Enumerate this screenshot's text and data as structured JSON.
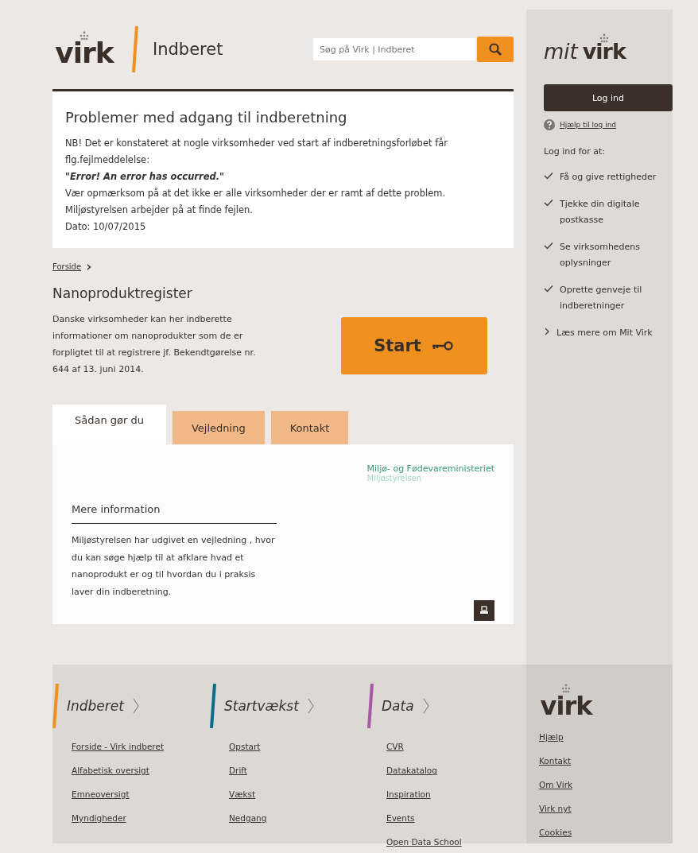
{
  "header": {
    "logo": "virk",
    "section": "Indberet",
    "search": {
      "placeholder": "Søg på Virk | Indberet"
    }
  },
  "notice": {
    "title": "Problemer med adgang til indberetning",
    "lines": [
      {
        "text": "NB! Det er konstateret at nogle virksomheder ved start af indberetningsforløbet får flg.fejlmeddelelse:",
        "emphasis": false
      },
      {
        "text": "\"Error! An error has occurred.\"",
        "emphasis": true
      },
      {
        "text": "Vær opmærksom på at det ikke er alle virksomheder der er ramt af dette problem.",
        "emphasis": false
      },
      {
        "text": "Miljøstyrelsen arbejder på at finde fejlen.",
        "emphasis": false
      },
      {
        "text": "Dato: 10/07/2015",
        "emphasis": false
      }
    ]
  },
  "breadcrumb": [
    "Forside"
  ],
  "page": {
    "title": "Nanoproduktregister",
    "intro": "Danske virksomheder kan her indberette informationer om nanoprodukter som de er forpligtet til at registrere jf. Bekendtgørelse nr. 644 af 13. juni 2014.",
    "start_button": "Start"
  },
  "tabs": [
    {
      "label": "Sådan gør du",
      "selected": true
    },
    {
      "label": "Vejledning",
      "selected": false
    },
    {
      "label": "Kontakt",
      "selected": false
    }
  ],
  "tab_panel": {
    "ministry": "Miljø- og Fødevareministeriet",
    "agency": "Miljøstyrelsen",
    "heading": "Mere information",
    "text": "Miljøstyrelsen har udgivet en vejledning , hvor du kan søge hjælp til at afklare hvad et nanoprodukt er og til hvordan du i praksis laver din indberetning."
  },
  "sidebar": {
    "logo_prefix": "mit",
    "logo": "virk",
    "login_button": "Log ind",
    "help_link": "Hjælp til log ind",
    "benefits_title": "Log ind for at:",
    "benefits": [
      "Få og give rettigheder",
      "Tjekke din digitale postkasse",
      "Se virksomhedens oplysninger",
      "Oprette genveje til indberetninger"
    ],
    "more_link": "Læs mere om Mit Virk"
  },
  "footer": {
    "columns": [
      {
        "title": "Indberet",
        "color": "#f0901e",
        "links": [
          "Forside - Virk indberet",
          "Alfabetisk oversigt",
          "Emneoversigt",
          "Myndigheder"
        ]
      },
      {
        "title": "Startvækst",
        "color": "#0e6b8a",
        "links": [
          "Opstart",
          "Drift",
          "Vækst",
          "Nedgang"
        ]
      },
      {
        "title": "Data",
        "color": "#a65aa6",
        "links": [
          "CVR",
          "Datakatalog",
          "Inspiration",
          "Events",
          "Open Data School"
        ]
      }
    ],
    "logo": "virk",
    "links": [
      "Hjælp",
      "Kontakt",
      "Om Virk",
      "Virk nyt",
      "Cookies"
    ]
  }
}
